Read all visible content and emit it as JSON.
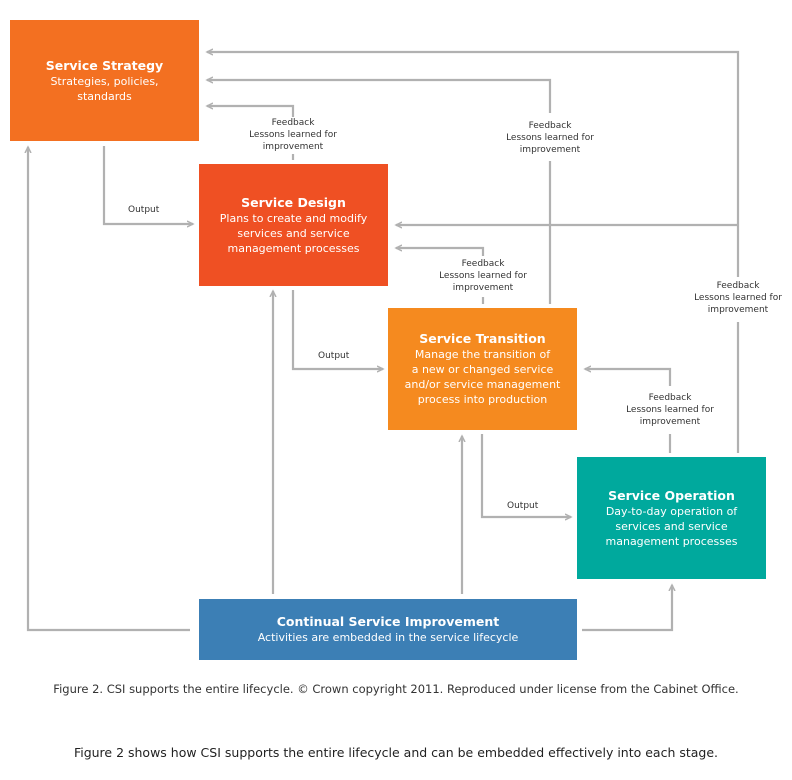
{
  "colors": {
    "strategy": "#F37021",
    "design": "#EF5023",
    "transition": "#F58A1F",
    "operation": "#00A99D",
    "csi": "#3C7FB5",
    "connector": "#B1B1B1"
  },
  "boxes": {
    "strategy": {
      "title": "Service Strategy",
      "desc_lines": [
        "Strategies, policies,",
        "standards"
      ]
    },
    "design": {
      "title": "Service Design",
      "desc_lines": [
        "Plans to create and modify",
        "services and service",
        "management processes"
      ]
    },
    "transition": {
      "title": "Service Transition",
      "desc_lines": [
        "Manage the transition of",
        "a new or changed service",
        "and/or service management",
        "process into production"
      ]
    },
    "operation": {
      "title": "Service Operation",
      "desc_lines": [
        "Day-to-day operation of",
        "services and service",
        "management processes"
      ]
    },
    "csi": {
      "title": "Continual Service Improvement",
      "desc_lines": [
        "Activities are embedded in the service lifecycle"
      ]
    }
  },
  "labels": {
    "output": "Output",
    "feedback": [
      "Feedback",
      "Lessons learned for",
      "improvement"
    ]
  },
  "caption": "Figure 2. CSI supports the entire lifecycle. © Crown copyright 2011. Reproduced under license from the Cabinet Office.",
  "body_text": "Figure 2 shows how CSI supports the entire lifecycle and can be embedded effectively into each stage."
}
